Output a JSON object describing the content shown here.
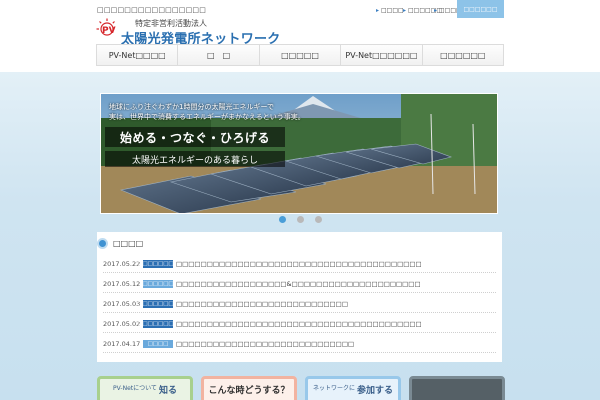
{
  "header": {
    "tagline": "□□□□□□□□□□□□□□□□",
    "utility_links": [
      "□□□□",
      "□□□□□□",
      "□□□□□□"
    ],
    "contact_label": "□□□□□□",
    "logo_text": "PV",
    "org_type": "特定非営利活動法人",
    "org_name": "太陽光発電所ネットワーク"
  },
  "nav": {
    "items": [
      "PV-Net□□□□",
      "□　□",
      "□□□□□",
      "PV-Net□□□□□□",
      "□□□□□□"
    ]
  },
  "slider": {
    "caption_lines": [
      "地球にふり注ぐわずか1時間分の太陽光エネルギーで",
      "実は、世界中で消費するエネルギーがまかなえるという事実。"
    ],
    "title": "始める・つなぐ・ひろげる",
    "subtitle": "太陽光エネルギーのある暮らし",
    "slide_count": 3,
    "active_slide": 1
  },
  "news": {
    "title": "□□□□",
    "items": [
      {
        "date": "2017.05.22",
        "category": "□□□□□□□□",
        "text": "□□□□□□□□□□□□□□□□□□□□□□□□□□□□□□□□□□□□□□□□",
        "style": "dark"
      },
      {
        "date": "2017.05.12",
        "category": "□□□□□□",
        "text": "□□□□□□□□□□□□□□□□□□&□□□□□□□□□□□□□□□□□□□□□",
        "style": "light"
      },
      {
        "date": "2017.05.03",
        "category": "□□□□□□□□",
        "text": "□□□□□□□□□□□□□□□□□□□□□□□□□□□□",
        "style": "dark"
      },
      {
        "date": "2017.05.02",
        "category": "□□□□□□□□",
        "text": "□□□□□□□□□□□□□□□□□□□□□□□□□□□□□□□□□□□□□□□□",
        "style": "dark"
      },
      {
        "date": "2017.04.17",
        "category": "□□□□",
        "text": "□□□□□□□□□□□□□□□□□□□□□□□□□□□□□",
        "style": "light"
      }
    ]
  },
  "cards": [
    {
      "small": "PV-Netについて",
      "large": "知る"
    },
    {
      "small": "",
      "large": "こんな時どうする？"
    },
    {
      "small": "ネットワークに",
      "large": "参加する"
    },
    {
      "small": "",
      "large": ""
    }
  ],
  "colors": {
    "brand_blue": "#2a6fb0",
    "logo_red": "#d6252a",
    "nav_active_dot": "#4a9ed8",
    "news_category_dark": "#2c6fb3",
    "news_category_light": "#6aa9dc"
  }
}
